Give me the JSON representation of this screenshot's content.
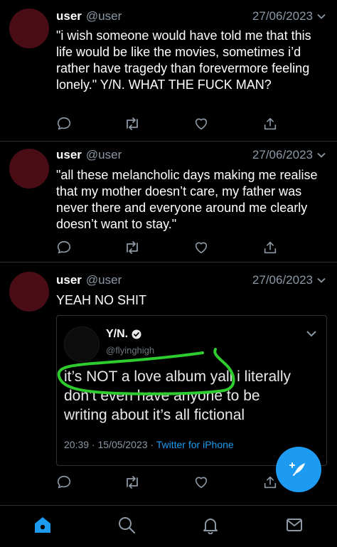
{
  "tweets": [
    {
      "name": "user",
      "handle": "@user",
      "date": "27/06/2023",
      "text": "\"i wish someone would have told me that this life would be like the movies, sometimes i’d rather have tragedy than forevermore feeling lonely.\" Y/N. WHAT THE FUCK MAN?"
    },
    {
      "name": "user",
      "handle": "@user",
      "date": "27/06/2023",
      "text": "\"all these melancholic days making me realise that my mother doesn’t care, my father was never there and everyone around me clearly doesn’t want to stay.\""
    },
    {
      "name": "user",
      "handle": "@user",
      "date": "27/06/2023",
      "text": "YEAH NO SHIT"
    }
  ],
  "quoted": {
    "name": "Y/N.",
    "handle": "@flyinghigh",
    "text": "it’s NOT a love album yall i literally don’t even have anyone to be writing about it’s all fictional",
    "time": "20:39 · 15/05/2023 · ",
    "source": "Twitter for iPhone",
    "annotation_color": "#2ecc2e"
  },
  "colors": {
    "background": "#000000",
    "accent": "#1d9bf0",
    "avatar": "#4a0d15",
    "secondary_text": "#8b98a5"
  },
  "icons": {
    "actions": [
      "reply-icon",
      "retweet-icon",
      "like-icon",
      "share-icon"
    ],
    "nav": [
      "home-icon",
      "search-icon",
      "notifications-icon",
      "messages-icon"
    ],
    "fab": "compose-icon"
  }
}
